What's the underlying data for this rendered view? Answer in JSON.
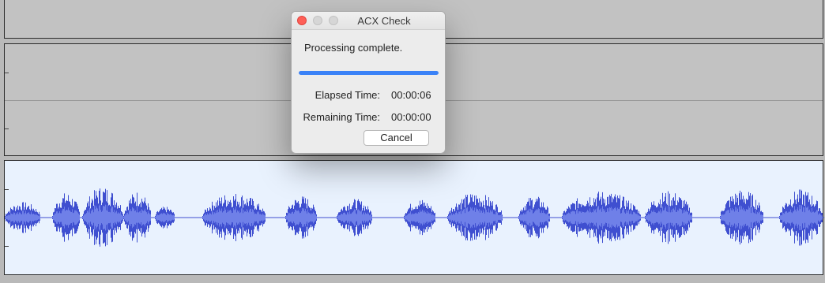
{
  "dialog": {
    "title": "ACX Check",
    "status": "Processing complete.",
    "progress_fraction": 1.0,
    "elapsed_label": "Elapsed Time:",
    "elapsed_value": "00:00:06",
    "remaining_label": "Remaining Time:",
    "remaining_value": "00:00:00",
    "cancel_label": "Cancel"
  },
  "colors": {
    "waveform": "#3f4fd0",
    "waveform_rms": "#6f80e8",
    "selected_track_bg": "#e9f2fe",
    "progress_accent": "#3a82f7"
  }
}
